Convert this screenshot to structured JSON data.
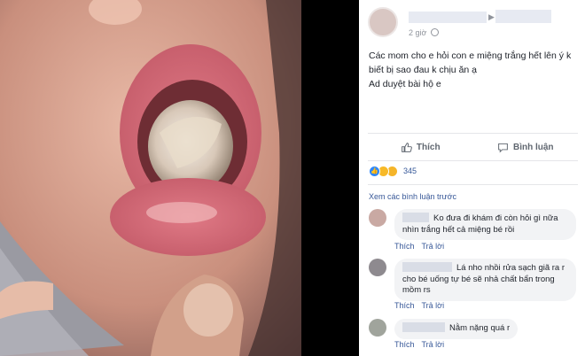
{
  "post": {
    "time": "2 giờ",
    "caption_lines": [
      "Các mom cho e hỏi con e miệng trắng hết lên ý k",
      "biết bị sao đau k chịu ăn ạ",
      "Ad duyệt bài hộ e"
    ]
  },
  "actions": {
    "like": "Thích",
    "comment": "Bình luận"
  },
  "reactions": {
    "count": "345",
    "icons": [
      "like-reaction",
      "haha-reaction",
      "sad-reaction"
    ],
    "colors": {
      "like": "#2d88ff",
      "haha": "#f7b928",
      "sad": "#f5b52a"
    }
  },
  "view_more": "Xem các bình luận trước",
  "comments": [
    {
      "lines": [
        "Ko đưa đi khám đi còn hỏi gì nữa",
        "nhìn trắng hết cả miệng bé rồi"
      ],
      "like": "Thích",
      "reply": "Trả lời"
    },
    {
      "lines": [
        "Lá nho nhồi rửa sạch giã ra r",
        "cho bé uống tự bé sẽ nhả chất bẩn trong",
        "mồm rs"
      ],
      "like": "Thích",
      "reply": "Trả lời"
    },
    {
      "lines": [
        "Nằm nặng quá r"
      ],
      "like": "Thích",
      "reply": "Trả lời"
    }
  ],
  "theme": {
    "link": "#385898",
    "text": "#1d2129",
    "muted": "#90949c"
  }
}
